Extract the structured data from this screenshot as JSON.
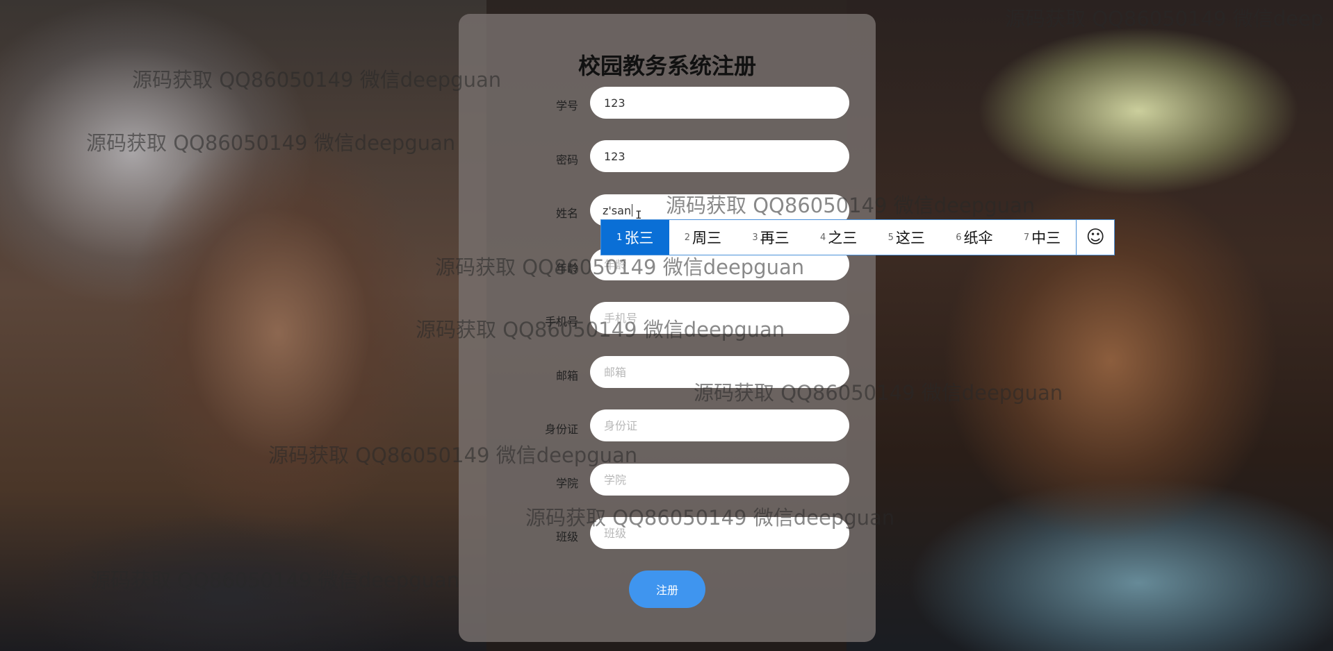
{
  "form": {
    "title": "校园教务系统注册",
    "fields": [
      {
        "label": "学号",
        "value": "123",
        "placeholder": ""
      },
      {
        "label": "密码",
        "value": "123",
        "placeholder": ""
      },
      {
        "label": "姓名",
        "value": "z'san",
        "placeholder": ""
      },
      {
        "label": "年龄",
        "value": "",
        "placeholder": "年龄"
      },
      {
        "label": "手机号",
        "value": "",
        "placeholder": "手机号"
      },
      {
        "label": "邮箱",
        "value": "",
        "placeholder": "邮箱"
      },
      {
        "label": "身份证",
        "value": "",
        "placeholder": "身份证"
      },
      {
        "label": "学院",
        "value": "",
        "placeholder": "学院"
      },
      {
        "label": "班级",
        "value": "",
        "placeholder": "班级"
      }
    ],
    "submit_label": "注册"
  },
  "ime": {
    "candidates": [
      {
        "num": "1",
        "text": "张三"
      },
      {
        "num": "2",
        "text": "周三"
      },
      {
        "num": "3",
        "text": "再三"
      },
      {
        "num": "4",
        "text": "之三"
      },
      {
        "num": "5",
        "text": "这三"
      },
      {
        "num": "6",
        "text": "纸伞"
      },
      {
        "num": "7",
        "text": "中三"
      }
    ],
    "emoji_icon": "☺"
  },
  "watermark": {
    "text": "源码获取 QQ86050149 微信deepguan",
    "text_clipped": "源码获取 QQ86050149 微信deep"
  },
  "colors": {
    "submit": "#3f95ef",
    "ime_selected": "#0a6fd6"
  }
}
